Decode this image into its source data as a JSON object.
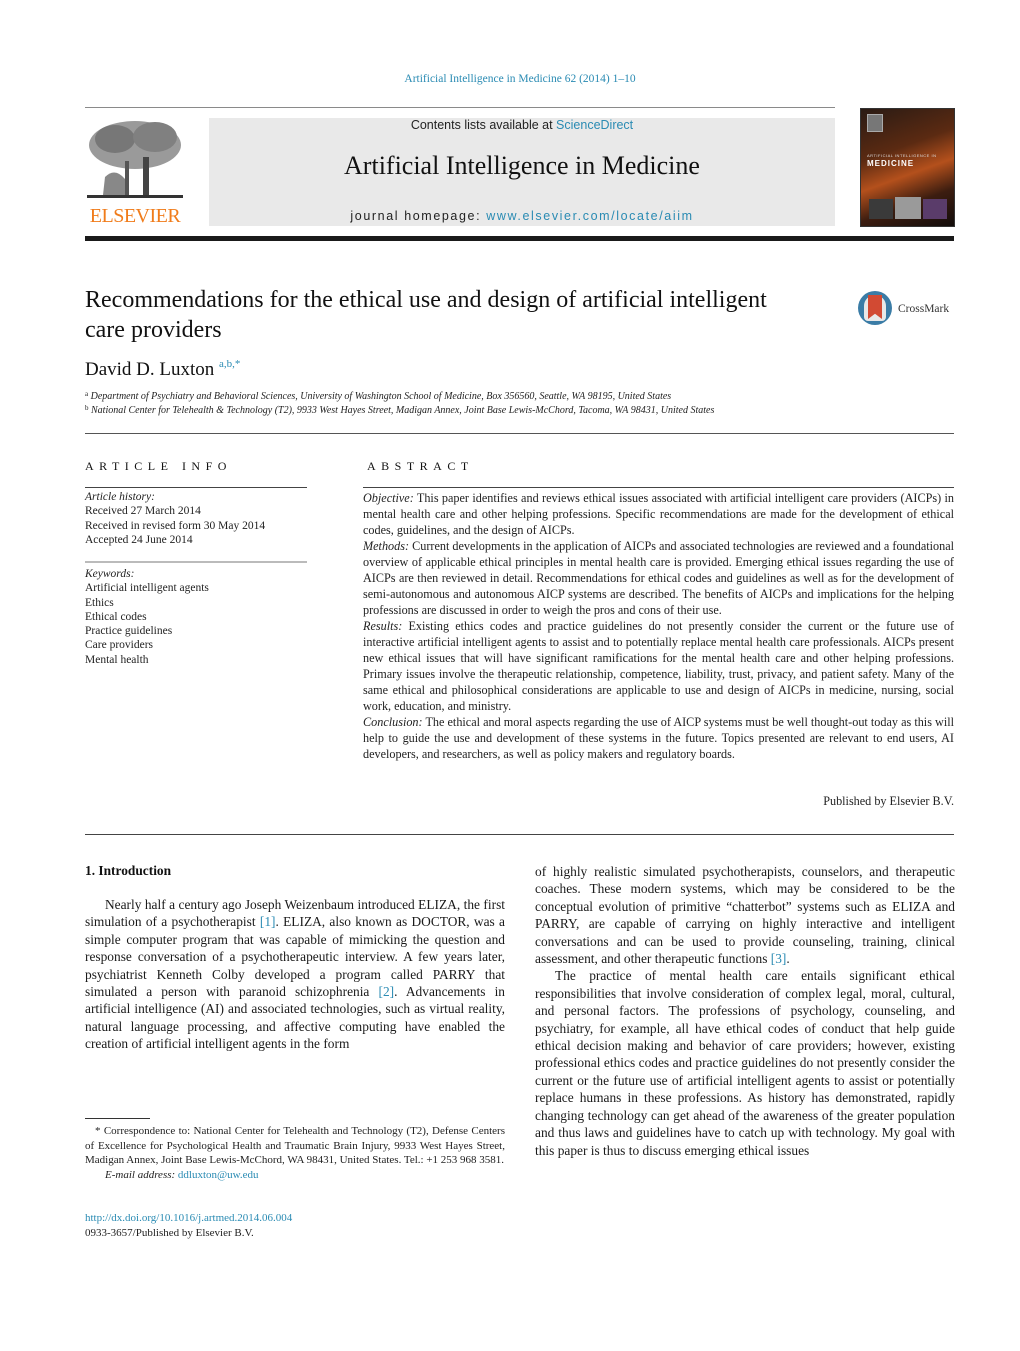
{
  "header": {
    "journal_ref": "Artificial Intelligence in Medicine 62 (2014) 1–10",
    "contents_prefix": "Contents lists available at ",
    "contents_link": "ScienceDirect",
    "journal_title": "Artificial Intelligence in Medicine",
    "homepage_prefix": "journal homepage: ",
    "homepage_link": "www.elsevier.com/locate/aiim",
    "publisher_logo_text": "ELSEVIER",
    "cover_title_small": "ARTIFICIAL INTELLIGENCE IN",
    "cover_title_large": "MEDICINE",
    "crossmark_label": "CrossMark"
  },
  "article": {
    "title": "Recommendations for the ethical use and design of artificial intelligent care providers",
    "author_name": "David D. Luxton",
    "author_marks": "a,b,*",
    "affiliations": [
      {
        "mark": "a",
        "text": "Department of Psychiatry and Behavioral Sciences, University of Washington School of Medicine, Box 356560, Seattle, WA 98195, United States"
      },
      {
        "mark": "b",
        "text": "National Center for Telehealth & Technology (T2), 9933 West Hayes Street, Madigan Annex, Joint Base Lewis-McChord, Tacoma, WA 98431, United States"
      }
    ]
  },
  "article_info": {
    "heading": "ARTICLE INFO",
    "history_label": "Article history:",
    "history": [
      "Received 27 March 2014",
      "Received in revised form 30 May 2014",
      "Accepted 24 June 2014"
    ],
    "keywords_label": "Keywords:",
    "keywords": [
      "Artificial intelligent agents",
      "Ethics",
      "Ethical codes",
      "Practice guidelines",
      "Care providers",
      "Mental health"
    ]
  },
  "abstract": {
    "heading": "ABSTRACT",
    "sections": [
      {
        "label": "Objective:",
        "text": " This paper identifies and reviews ethical issues associated with artificial intelligent care providers (AICPs) in mental health care and other helping professions. Specific recommendations are made for the development of ethical codes, guidelines, and the design of AICPs."
      },
      {
        "label": "Methods:",
        "text": " Current developments in the application of AICPs and associated technologies are reviewed and a foundational overview of applicable ethical principles in mental health care is provided. Emerging ethical issues regarding the use of AICPs are then reviewed in detail. Recommendations for ethical codes and guidelines as well as for the development of semi-autonomous and autonomous AICP systems are described. The benefits of AICPs and implications for the helping professions are discussed in order to weigh the pros and cons of their use."
      },
      {
        "label": "Results:",
        "text": " Existing ethics codes and practice guidelines do not presently consider the current or the future use of interactive artificial intelligent agents to assist and to potentially replace mental health care professionals. AICPs present new ethical issues that will have significant ramifications for the mental health care and other helping professions. Primary issues involve the therapeutic relationship, competence, liability, trust, privacy, and patient safety. Many of the same ethical and philosophical considerations are applicable to use and design of AICPs in medicine, nursing, social work, education, and ministry."
      },
      {
        "label": "Conclusion:",
        "text": " The ethical and moral aspects regarding the use of AICP systems must be well thought-out today as this will help to guide the use and development of these systems in the future. Topics presented are relevant to end users, AI developers, and researchers, as well as policy makers and regulatory boards."
      }
    ],
    "published_by": "Published by Elsevier B.V."
  },
  "body": {
    "section_heading": "1.  Introduction",
    "left_para": {
      "p1": "Nearly half a century ago Joseph Weizenbaum introduced ELIZA, the first simulation of a psychotherapist ",
      "ref1": "[1]",
      "p2": ". ELIZA, also known as DOCTOR, was a simple computer program that was capable of mimicking the question and response conversation of a psychotherapeutic interview. A few years later, psychiatrist Kenneth Colby developed a program called PARRY that simulated a person with paranoid schizophrenia ",
      "ref2": "[2]",
      "p3": ". Advancements in artificial intelligence (AI) and associated technologies, such as virtual reality, natural language processing, and affective computing have enabled the creation of artificial intelligent agents in the form"
    },
    "right_para1": {
      "text": "of highly realistic simulated psychotherapists, counselors, and therapeutic coaches. These modern systems, which may be considered to be the conceptual evolution of primitive “chatterbot” systems such as ELIZA and PARRY, are capable of carrying on highly interactive and intelligent conversations and can be used to provide counseling, training, clinical assessment, and other therapeutic functions ",
      "ref3": "[3]",
      "end": "."
    },
    "right_para2": "The practice of mental health care entails significant ethical responsibilities that involve consideration of complex legal, moral, cultural, and personal factors. The professions of psychology, counseling, and psychiatry, for example, all have ethical codes of conduct that help guide ethical decision making and behavior of care providers; however, existing professional ethics codes and practice guidelines do not presently consider the current or the future use of artificial intelligent agents to assist or potentially replace humans in these professions. As history has demonstrated, rapidly changing technology can get ahead of the awareness of the greater population and thus laws and guidelines have to catch up with technology. My goal with this paper is thus to discuss emerging ethical issues"
  },
  "footnote": {
    "correspondence": "* Correspondence to: National Center for Telehealth and Technology (T2), Defense Centers of Excellence for Psychological Health and Traumatic Brain Injury, 9933 West Hayes Street, Madigan Annex, Joint Base Lewis-McChord, WA 98431, United States. Tel.: +1 253 968 3581.",
    "email_label": "E-mail address: ",
    "email": "ddluxton@uw.edu",
    "doi": "http://dx.doi.org/10.1016/j.artmed.2014.06.004",
    "issn": "0933-3657/Published by Elsevier B.V."
  },
  "colors": {
    "link": "#2a8bb3",
    "elsevier_orange": "#f07c1b",
    "banner_gray": "#e9e9e9",
    "crossmark_blue": "#3a7ca6",
    "crossmark_red": "#d24a33"
  }
}
